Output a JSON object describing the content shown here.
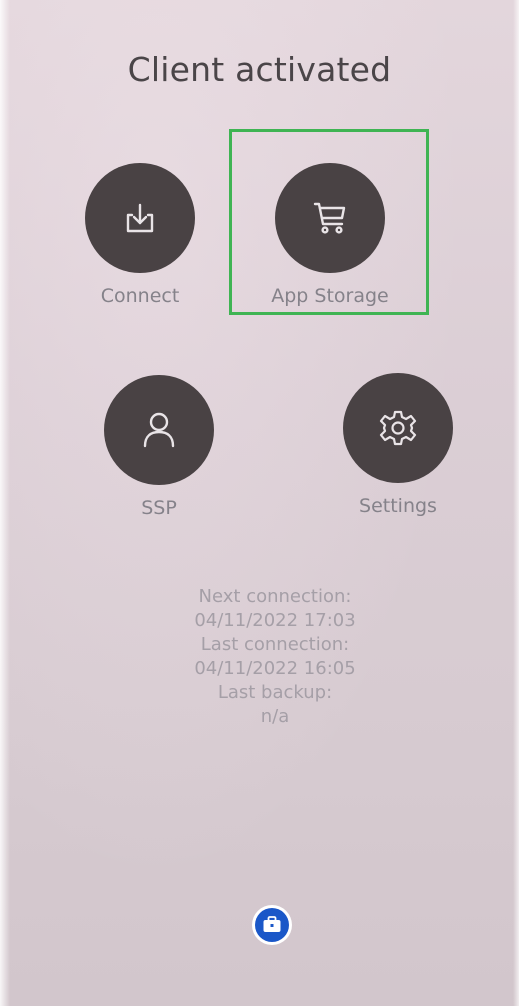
{
  "title": "Client activated",
  "tiles": [
    {
      "label": "Connect",
      "icon": "download-icon"
    },
    {
      "label": "App Storage",
      "icon": "cart-icon"
    },
    {
      "label": "SSP",
      "icon": "user-icon"
    },
    {
      "label": "Settings",
      "icon": "gear-icon"
    }
  ],
  "info": {
    "next_label": "Next connection:",
    "next_value": "04/11/2022 17:03",
    "last_label": "Last connection:",
    "last_value": "04/11/2022 16:05",
    "backup_label": "Last backup:",
    "backup_value": "n/a"
  },
  "bottom_button": {
    "icon": "briefcase-icon"
  },
  "colors": {
    "background": "#dbced5",
    "circle": "#494244",
    "highlight": "#3fb453",
    "accent_blue": "#1a57c8"
  }
}
